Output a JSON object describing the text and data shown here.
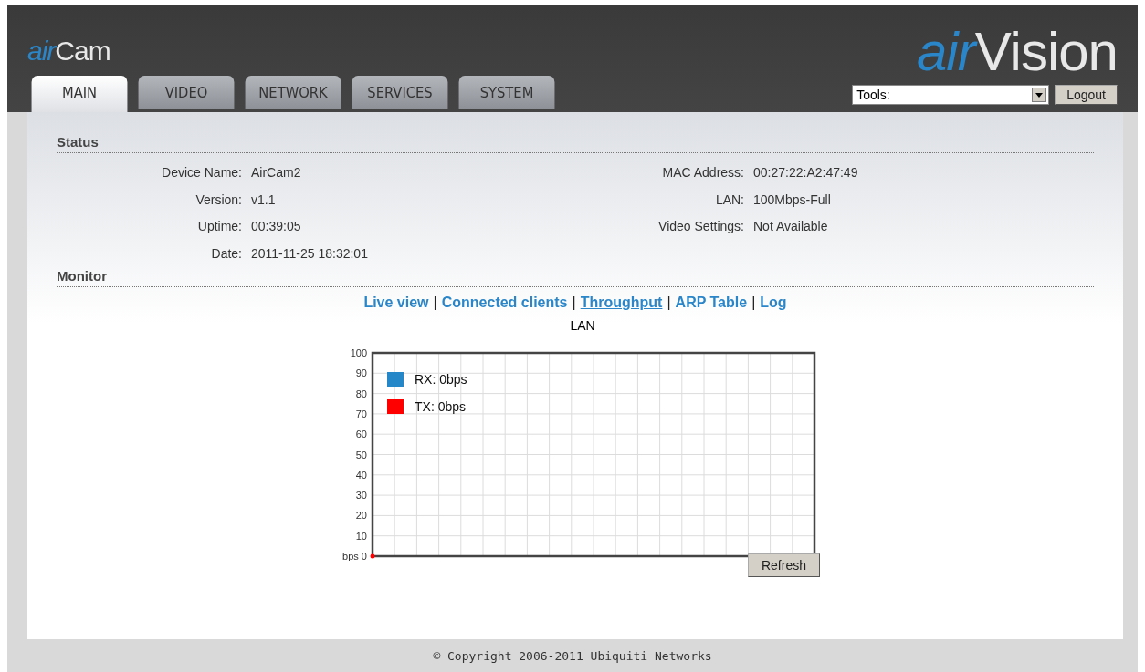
{
  "header": {
    "logo_left": {
      "prefix": "air",
      "name": "Cam"
    },
    "logo_right": {
      "prefix": "air",
      "name": "Vision"
    },
    "tools": {
      "value": "Tools:"
    },
    "logout": "Logout"
  },
  "tabs": [
    {
      "label": "MAIN",
      "selected": true
    },
    {
      "label": "VIDEO",
      "selected": false
    },
    {
      "label": "NETWORK",
      "selected": false
    },
    {
      "label": "SERVICES",
      "selected": false
    },
    {
      "label": "SYSTEM",
      "selected": false
    }
  ],
  "status": {
    "title": "Status",
    "left": [
      {
        "label": "Device Name:",
        "value": "AirCam2"
      },
      {
        "label": "Version:",
        "value": "v1.1"
      },
      {
        "label": "Uptime:",
        "value": "00:39:05"
      },
      {
        "label": "Date:",
        "value": "2011-11-25 18:32:01"
      }
    ],
    "right": [
      {
        "label": "MAC Address:",
        "value": "00:27:22:A2:47:49"
      },
      {
        "label": "LAN:",
        "value": "100Mbps-Full"
      },
      {
        "label": "Video Settings:",
        "value": "Not Available"
      }
    ]
  },
  "monitor": {
    "title": "Monitor",
    "links": [
      {
        "label": "Live view",
        "selected": false
      },
      {
        "label": "Connected clients",
        "selected": false
      },
      {
        "label": "Throughput",
        "selected": true
      },
      {
        "label": "ARP Table",
        "selected": false
      },
      {
        "label": "Log",
        "selected": false
      }
    ],
    "separator": "|",
    "chart": {
      "title": "LAN",
      "y_axis_labels": [
        "100",
        "90",
        "80",
        "70",
        "60",
        "50",
        "40",
        "30",
        "20",
        "10",
        "bps 0"
      ],
      "legend": [
        {
          "label": "RX: 0bps",
          "color": "#2586c8"
        },
        {
          "label": "TX: 0bps",
          "color": "#ff0000"
        }
      ]
    },
    "refresh": "Refresh"
  },
  "footer": "© Copyright 2006-2011 Ubiquiti Networks"
}
